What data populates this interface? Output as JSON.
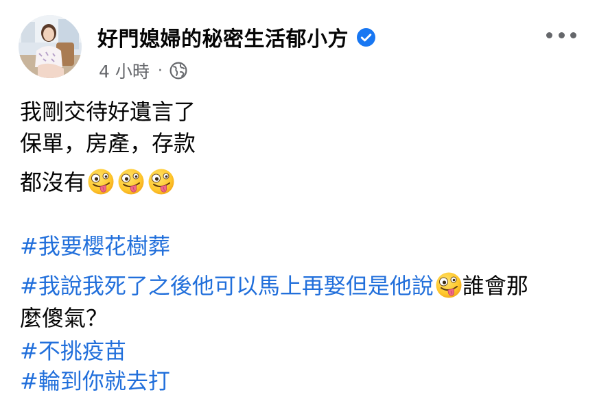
{
  "post": {
    "author": "好門媳婦的秘密生活郁小方",
    "verified_icon": "verified-badge-icon",
    "timestamp": "4 小時",
    "separator": "·",
    "audience_icon": "globe-icon",
    "more_icon": "more-options-icon",
    "lines": {
      "l1": "我剛交待好遺言了",
      "l2": "保單，房產，存款",
      "l3": "都沒有",
      "l4": "#我要櫻花樹葬",
      "l5_tag": "#我說我死了之後他可以馬上再娶但是他說",
      "l5_rest": "誰會那",
      "l6": "麼傻氣？",
      "l7": "#不挑疫苗",
      "l8": "#輪到你就去打"
    },
    "emoji_icon": "zany-face-emoji-icon",
    "colors": {
      "hashtag": "#216fdb",
      "verified": "#1877f2",
      "meta": "#65676b",
      "text": "#050505"
    }
  }
}
